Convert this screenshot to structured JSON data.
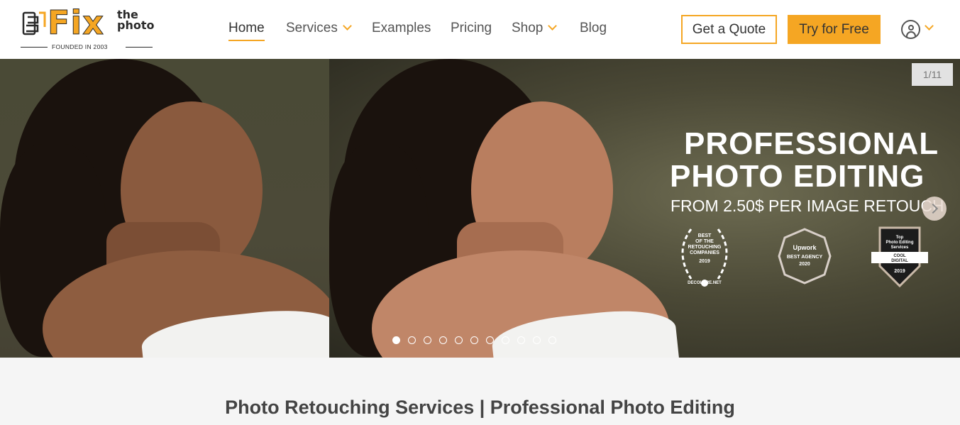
{
  "logo": {
    "word": "Fix",
    "word_top": "the",
    "word_bottom": "photo",
    "founded": "FOUNDED IN 2003",
    "brand_color": "#f5a623"
  },
  "nav": {
    "items": [
      {
        "label": "Home",
        "active": true,
        "has_dropdown": false
      },
      {
        "label": "Services",
        "active": false,
        "has_dropdown": true
      },
      {
        "label": "Examples",
        "active": false,
        "has_dropdown": false
      },
      {
        "label": "Pricing",
        "active": false,
        "has_dropdown": false
      },
      {
        "label": "Shop",
        "active": false,
        "has_dropdown": true
      },
      {
        "label": "Blog",
        "active": false,
        "has_dropdown": false
      }
    ]
  },
  "header_actions": {
    "quote_label": "Get a Quote",
    "try_label": "Try for Free",
    "user_icon": "user-icon"
  },
  "hero": {
    "counter": "1/11",
    "title_line1": "PROFESSIONAL",
    "title_line2": "PHOTO EDITING",
    "subtitle": "FROM 2.50$ PER IMAGE RETOUCH",
    "badges": [
      {
        "lines": [
          "BEST",
          "OF THE",
          "RETOUCHING",
          "COMPANIES",
          "2019"
        ],
        "footer": "DECOLORE.NET"
      },
      {
        "lines": [
          "Upwork",
          "BEST AGENCY",
          "2020"
        ]
      },
      {
        "lines": [
          "Top",
          "Photo Editing",
          "Services",
          "COOL",
          "DIGITAL",
          "2019"
        ]
      }
    ],
    "slide_count": 11,
    "active_slide": 1
  },
  "section": {
    "title": "Photo Retouching Services | Professional Photo Editing"
  }
}
